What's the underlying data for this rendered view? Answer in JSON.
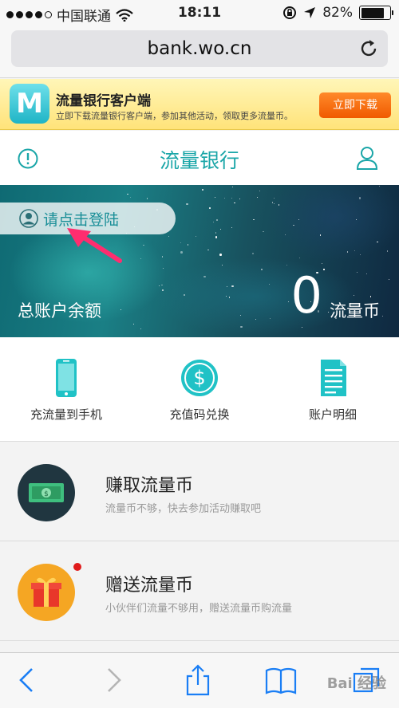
{
  "status_bar": {
    "carrier": "中国联通",
    "time": "18:11",
    "battery_percent": "82%",
    "battery_level": 0.82
  },
  "browser": {
    "url": "bank.wo.cn"
  },
  "app_banner": {
    "logo_letter": "M",
    "title": "流量银行客户端",
    "subtitle": "立即下载流量银行客户端，参加其他活动，领取更多流量币。",
    "download_label": "立即下载"
  },
  "header": {
    "title": "流量银行"
  },
  "hero": {
    "login_label": "请点击登陆",
    "balance_label": "总账户余额",
    "balance_value": "0",
    "balance_unit": "流量币"
  },
  "shortcuts": [
    {
      "label": "充流量到手机",
      "icon": "phone-icon"
    },
    {
      "label": "充值码兑换",
      "icon": "dollar-coin-icon"
    },
    {
      "label": "账户明细",
      "icon": "document-icon"
    }
  ],
  "list": [
    {
      "title": "赚取流量币",
      "subtitle": "流量币不够，快去参加活动赚取吧",
      "icon": "money-icon",
      "color": "#203640"
    },
    {
      "title": "赠送流量币",
      "subtitle": "小伙伴们流量不够用，赠送流量币购流量",
      "icon": "gift-icon",
      "color": "#f5a623"
    }
  ],
  "colors": {
    "accent": "#1aa6a8",
    "shortcut_icon": "#20c2c6",
    "download_button": "#f36a0c",
    "notification_dot": "#e01b1b"
  },
  "toolbar": {
    "watermark": "Bai 经验"
  }
}
